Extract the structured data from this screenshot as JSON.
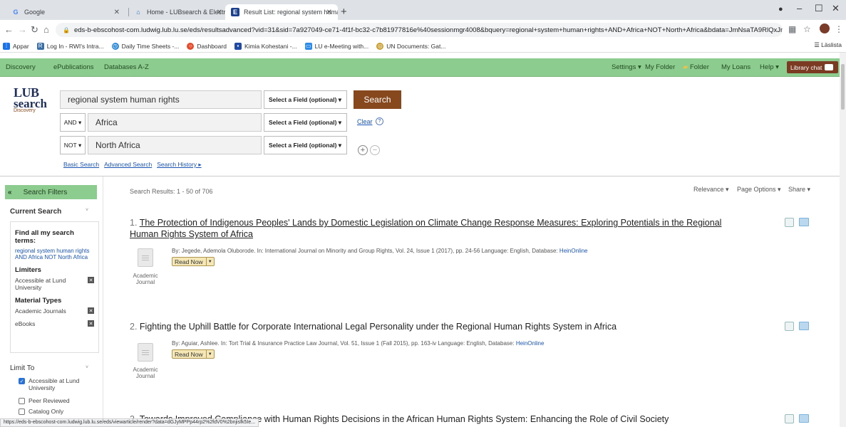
{
  "browser": {
    "tabs": [
      {
        "label": "Google",
        "icon": "google-icon"
      },
      {
        "label": "Home - LUBsearch & Electronic R",
        "icon": "home-icon"
      },
      {
        "label": "Result List: regional system huma",
        "icon": "ebsco-icon"
      }
    ],
    "url": "eds-b-ebscohost-com.ludwig.lub.lu.se/eds/resultsadvanced?vid=31&sid=7a927049-ce71-4f1f-bc32-c7b81977816e%40sessionmgr4008&bquery=regional+system+human+rights+AND+Africa+NOT+North+Africa&bdata=JmNsaTA9RlQxJmNsdjA9...",
    "bookmarks": [
      {
        "label": "Appar",
        "icon": "apps-icon",
        "color": "#1a73e8"
      },
      {
        "label": "Log In - RWI's Intra...",
        "icon": "rwi-icon",
        "color": "#3a6ea5"
      },
      {
        "label": "Daily Time Sheets -...",
        "icon": "timesheet-icon",
        "color": "#2a8ad6"
      },
      {
        "label": "Dashboard",
        "icon": "dashboard-icon",
        "color": "#e44b2b"
      },
      {
        "label": "Kimia Kohestani -...",
        "icon": "user-icon",
        "color": "#1f4aa5"
      },
      {
        "label": "LU e-Meeting with...",
        "icon": "meeting-icon",
        "color": "#2d8ce8"
      },
      {
        "label": "UN Documents: Gat...",
        "icon": "un-icon",
        "color": "#c79b2a"
      }
    ],
    "reading_list": "Läslista",
    "status_url": "https://eds-b-ebscohost-com.ludwig.lub.lu.se/eds/viewarticle/render?data=dGJyMPPp44rp2%2fdV0%2bnjisfk5Ie..."
  },
  "nav": {
    "left": [
      "Discovery",
      "ePublications",
      "Databases A-Z"
    ],
    "right": [
      "Settings",
      "My Folder",
      "Folder",
      "My Loans",
      "Help"
    ],
    "library_chat": "Library chat"
  },
  "logo": {
    "line1": "LUB",
    "line2": "search",
    "line3": "Discovery"
  },
  "search": {
    "rows": [
      {
        "bool": "",
        "term": "regional system human rights",
        "field": "Select a Field (optional)"
      },
      {
        "bool": "AND",
        "term": "Africa",
        "field": "Select a Field (optional)"
      },
      {
        "bool": "NOT",
        "term": "North Africa",
        "field": "Select a Field (optional)"
      }
    ],
    "search_button": "Search",
    "clear": "Clear",
    "links": [
      "Basic Search",
      "Advanced Search",
      "Search History"
    ]
  },
  "sidebar": {
    "header": "Search Filters",
    "current_search": "Current Search",
    "find_all": "Find all my search terms:",
    "terms": "regional system human rights AND Africa NOT North Africa",
    "limiters_title": "Limiters",
    "limiters": [
      "Accessible at Lund University"
    ],
    "material_title": "Material Types",
    "materials": [
      "Academic Journals",
      "eBooks"
    ],
    "limit_to": "Limit To",
    "limit_options": [
      {
        "label": "Accessible at Lund University",
        "checked": true
      },
      {
        "label": "Peer Reviewed",
        "checked": false
      },
      {
        "label": "Catalog Only",
        "checked": false
      }
    ]
  },
  "results": {
    "summary": "Search Results: 1 - 50 of 706",
    "sort": [
      "Relevance",
      "Page Options",
      "Share"
    ],
    "read_now": "Read Now",
    "items": [
      {
        "num": "1.",
        "title_line1": "The Protection of Indigenous Peoples' Lands by Domestic Legislation on Climate Change Response Measures: Exploring Potentials in the Regional",
        "title_line2": "Human Rights System of Africa",
        "meta": "By: Jegede, Ademola Oluborode. In: International Journal on Minority and Group Rights, Vol. 24, Issue 1 (2017), pp. 24-56 Language: English, Database:",
        "db": "HeinOnline",
        "pubtype": "Academic Journal"
      },
      {
        "num": "2.",
        "title_line1": "Fighting the Uphill Battle for Corporate International Legal Personality under the Regional Human Rights System in Africa",
        "meta": "By: Aguiar, Ashlee. In: Tort Trial & Insurance Practice Law Journal, Vol. 51, Issue 1 (Fall 2015), pp. 163-iv Language: English, Database:",
        "db": "HeinOnline",
        "pubtype": "Academic Journal"
      },
      {
        "num": "3.",
        "title_line1": "Towards Improved Compliance with Human Rights Decisions in the African Human Rights System: Enhancing the Role of Civil Society"
      }
    ]
  }
}
